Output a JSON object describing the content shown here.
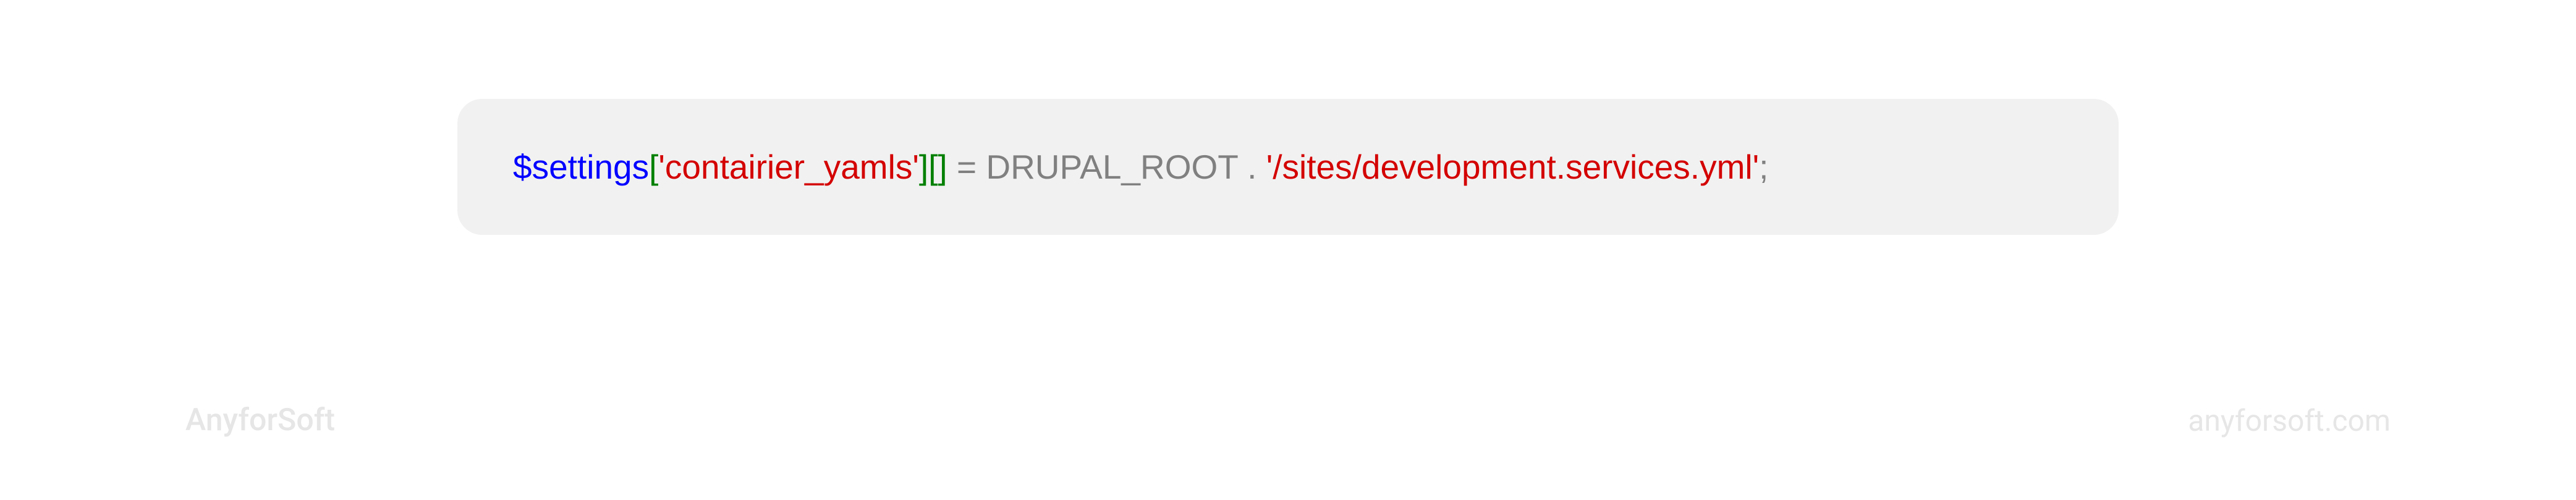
{
  "code": {
    "var": "$settings",
    "br_open1": "[",
    "key": "'contairier_yamls'",
    "br_close1": "]",
    "br_open2": "[",
    "br_close2": "]",
    "assign": " = DRUPAL_ROOT . ",
    "path": "'/sites/development.services.yml'",
    "semi": ";"
  },
  "footer": {
    "logo": "AnyforSoft",
    "url": "anyforsoft.com"
  }
}
